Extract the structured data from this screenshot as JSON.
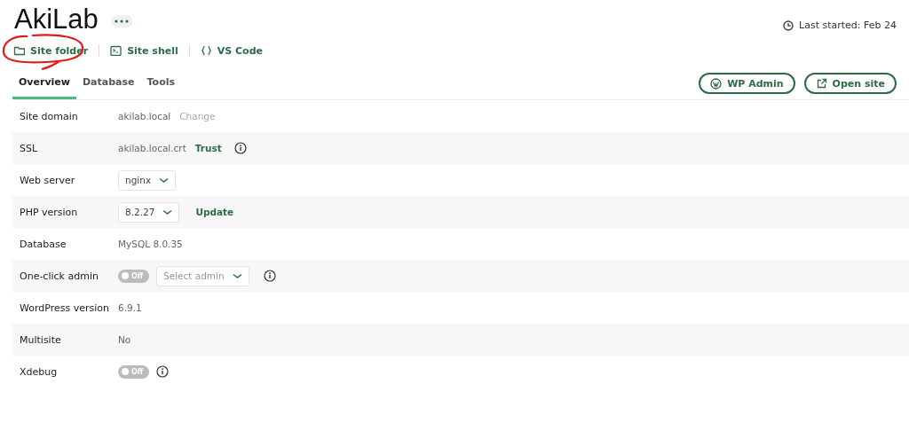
{
  "site": {
    "title": "AkiLab",
    "last_started": "Last started: Feb 24"
  },
  "actions": [
    {
      "kind": "folder",
      "label": "Site folder",
      "circled": true
    },
    {
      "kind": "shell",
      "label": "Site shell",
      "circled": false
    },
    {
      "kind": "code",
      "label": "VS Code",
      "circled": false
    }
  ],
  "tabs": [
    {
      "label": "Overview",
      "selected": true
    },
    {
      "label": "Database",
      "selected": false
    },
    {
      "label": "Tools",
      "selected": false
    }
  ],
  "buttons": [
    {
      "kind": "wordpress",
      "label": "WP Admin"
    },
    {
      "kind": "external",
      "label": "Open site"
    }
  ],
  "rows": [
    {
      "label": "Site domain",
      "items": [
        {
          "kind": "text",
          "text": "akilab.local"
        },
        {
          "kind": "link",
          "text": "Change",
          "disabled": true
        }
      ]
    },
    {
      "label": "SSL",
      "items": [
        {
          "kind": "text",
          "text": "akilab.local.crt"
        },
        {
          "kind": "link",
          "text": "Trust",
          "disabled": false
        },
        {
          "kind": "info"
        }
      ]
    },
    {
      "label": "Web server",
      "items": [
        {
          "kind": "select",
          "value": "nginx"
        }
      ]
    },
    {
      "label": "PHP version",
      "items": [
        {
          "kind": "select",
          "value": "8.2.27"
        },
        {
          "kind": "link",
          "text": "Update",
          "disabled": false
        }
      ]
    },
    {
      "label": "Database",
      "items": [
        {
          "kind": "text",
          "text": "MySQL 8.0.35"
        }
      ]
    },
    {
      "label": "One-click admin",
      "items": [
        {
          "kind": "toggle",
          "on": false,
          "text": "Off"
        },
        {
          "kind": "select",
          "placeholder": "Select admin"
        },
        {
          "kind": "info"
        }
      ]
    },
    {
      "label": "WordPress version",
      "items": [
        {
          "kind": "text",
          "text": "6.9.1"
        }
      ]
    },
    {
      "label": "Multisite",
      "items": [
        {
          "kind": "text",
          "text": "No"
        }
      ]
    },
    {
      "label": "Xdebug",
      "items": [
        {
          "kind": "toggle",
          "on": false,
          "text": "Off"
        },
        {
          "kind": "info"
        }
      ]
    }
  ]
}
